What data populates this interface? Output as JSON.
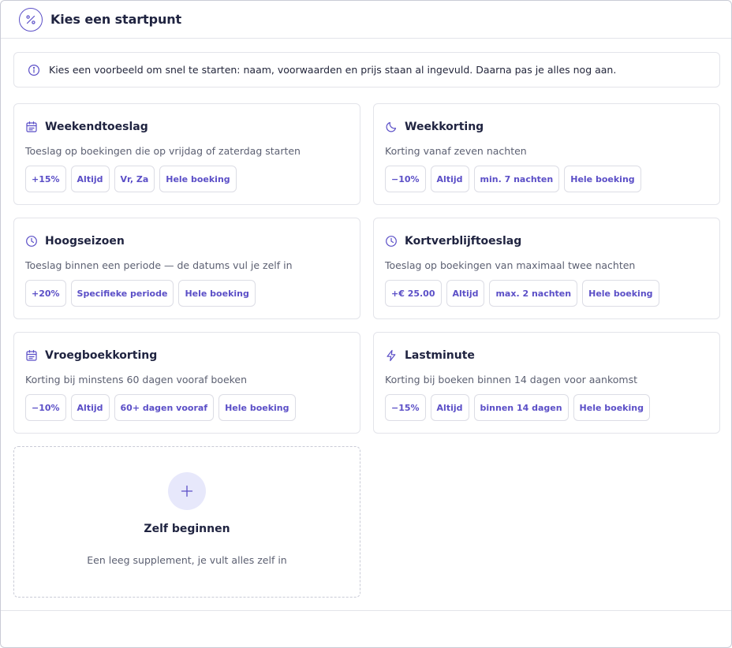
{
  "header": {
    "title": "Kies een startpunt",
    "icon": "percent-icon"
  },
  "info": {
    "icon": "info-icon",
    "text": "Kies een voorbeeld om snel te starten: naam, voorwaarden en prijs staan al ingevuld. Daarna pas je alles nog aan."
  },
  "accent_color": "#5b4fc7",
  "cards": [
    {
      "icon": "calendar-icon",
      "title": "Weekendtoeslag",
      "description": "Toeslag op boekingen die op vrijdag of zaterdag starten",
      "chips": [
        "+15%",
        "Altijd",
        "Vr, Za",
        "Hele boeking"
      ]
    },
    {
      "icon": "moon-icon",
      "title": "Weekkorting",
      "description": "Korting vanaf zeven nachten",
      "chips": [
        "−10%",
        "Altijd",
        "min. 7 nachten",
        "Hele boeking"
      ]
    },
    {
      "icon": "clock-icon",
      "title": "Hoogseizoen",
      "description": "Toeslag binnen een periode — de datums vul je zelf in",
      "chips": [
        "+20%",
        "Specifieke periode",
        "Hele boeking"
      ]
    },
    {
      "icon": "clock-icon",
      "title": "Kortverblijftoeslag",
      "description": "Toeslag op boekingen van maximaal twee nachten",
      "chips": [
        "+€ 25.00",
        "Altijd",
        "max. 2 nachten",
        "Hele boeking"
      ]
    },
    {
      "icon": "calendar-icon",
      "title": "Vroegboekkorting",
      "description": "Korting bij minstens 60 dagen vooraf boeken",
      "chips": [
        "−10%",
        "Altijd",
        "60+ dagen vooraf",
        "Hele boeking"
      ]
    },
    {
      "icon": "lightning-icon",
      "title": "Lastminute",
      "description": "Korting bij boeken binnen 14 dagen voor aankomst",
      "chips": [
        "−15%",
        "Altijd",
        "binnen 14 dagen",
        "Hele boeking"
      ]
    }
  ],
  "custom": {
    "icon": "plus-icon",
    "title": "Zelf beginnen",
    "description": "Een leeg supplement, je vult alles zelf in"
  }
}
